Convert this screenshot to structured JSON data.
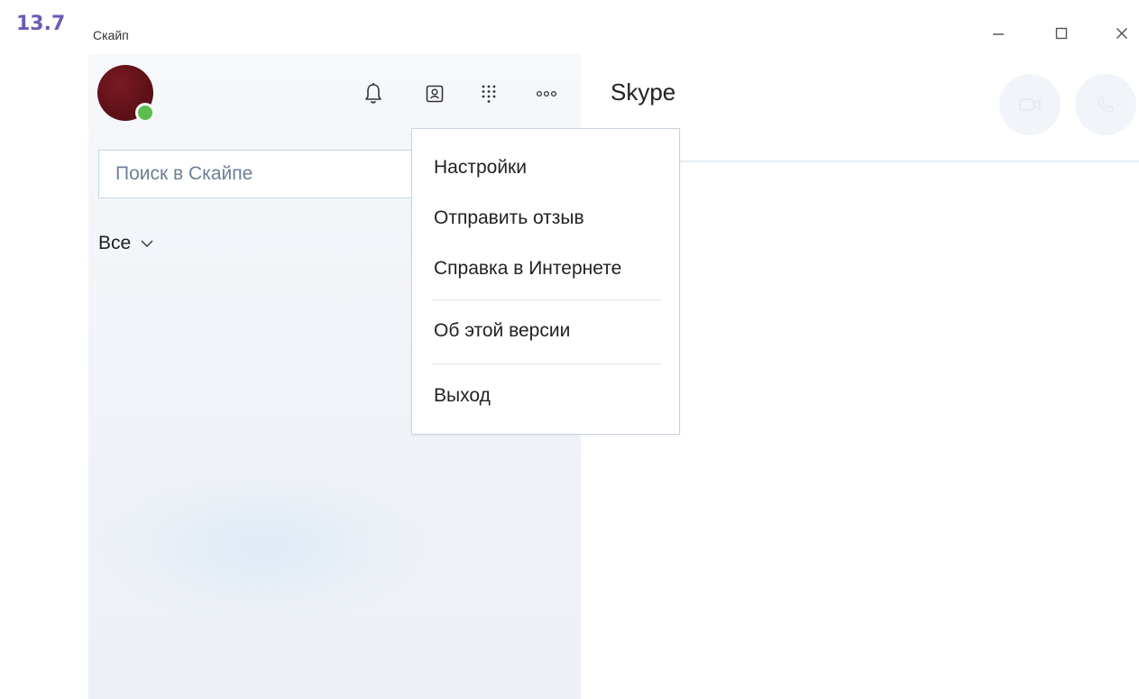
{
  "figure_label": "13.7",
  "window": {
    "title": "Скайп",
    "controls": {
      "minimize": "—",
      "maximize": "☐",
      "close": "✕"
    }
  },
  "sidebar": {
    "avatar": {
      "presence_color": "#5cbc4d"
    },
    "toolbar": [
      "bell-icon",
      "contacts-icon",
      "dialpad-icon",
      "more-icon"
    ],
    "search": {
      "placeholder": "Поиск в Скайпе"
    },
    "filter": {
      "label": "Все",
      "chevron": "⌵"
    }
  },
  "main": {
    "title": "Skype"
  },
  "menu": {
    "items": [
      {
        "label": "Настройки"
      },
      {
        "label": "Отправить отзыв"
      },
      {
        "label": "Справка в Интернете"
      },
      {
        "label": "Об этой версии"
      },
      {
        "label": "Выход"
      }
    ]
  },
  "colors": {
    "figure_label": "#6b5bb5",
    "avatar": "#5a0f16",
    "search_border": "#c9d6e6",
    "call_button_bg": "#f1f5fa"
  }
}
